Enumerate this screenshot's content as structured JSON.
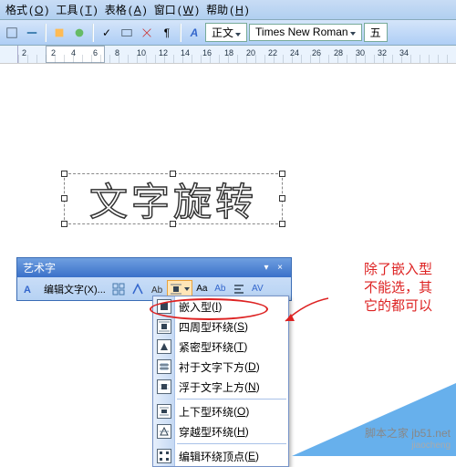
{
  "menu": {
    "format": {
      "label": "格式",
      "key": "O"
    },
    "tools": {
      "label": "工具",
      "key": "T"
    },
    "table": {
      "label": "表格",
      "key": "A"
    },
    "window": {
      "label": "窗口",
      "key": "W"
    },
    "help": {
      "label": "帮助",
      "key": "H"
    }
  },
  "toolbar": {
    "style_label": "正文",
    "font_name": "Times New Roman",
    "size_label": "五"
  },
  "ruler": {
    "marks": [
      "2",
      "2",
      "4",
      "6",
      "8",
      "10",
      "12",
      "14",
      "16",
      "18",
      "20",
      "22",
      "24",
      "26",
      "28",
      "30",
      "32",
      "34"
    ]
  },
  "wordart_text": "文字旋转",
  "wordart_toolbar": {
    "title": "艺术字",
    "edit_text": "编辑文字(X)..."
  },
  "wrap_menu": {
    "items": [
      {
        "label": "嵌入型",
        "key": "I",
        "circled": true
      },
      {
        "label": "四周型环绕",
        "key": "S"
      },
      {
        "label": "紧密型环绕",
        "key": "T"
      },
      {
        "label": "衬于文字下方",
        "key": "D"
      },
      {
        "label": "浮于文字上方",
        "key": "N"
      },
      {
        "label": "上下型环绕",
        "key": "O"
      },
      {
        "label": "穿越型环绕",
        "key": "H"
      },
      {
        "label": "编辑环绕顶点",
        "key": "E"
      }
    ]
  },
  "annotation": {
    "line1": "除了嵌入型",
    "line2": "不能选，其",
    "line3": "它的都可以"
  },
  "watermark": {
    "main": "脚本之家 jb51.net",
    "sub": "jiaocheng"
  }
}
